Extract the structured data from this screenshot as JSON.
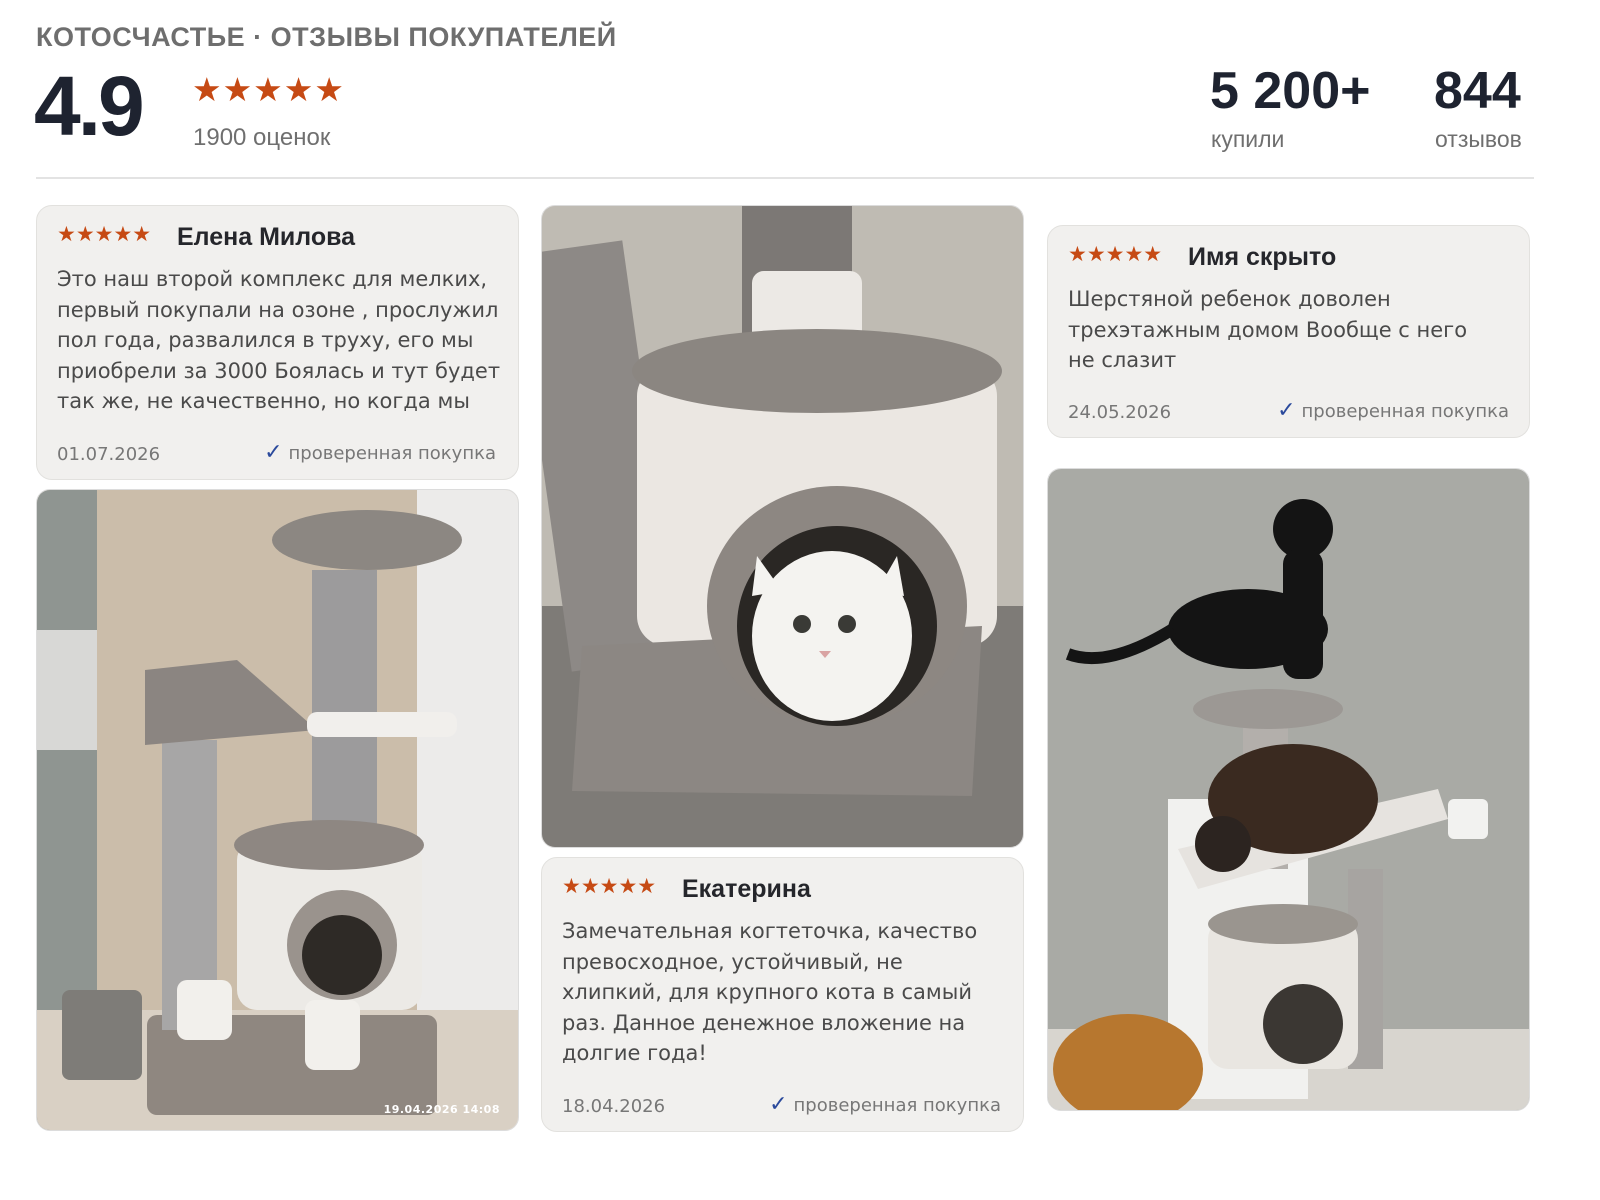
{
  "header": {
    "brand": "КОТОСЧАСТЬЕ · ОТЗЫВЫ ПОКУПАТЕЛЕЙ",
    "rating": "4.9",
    "stars": "★★★★★",
    "ratings_count": "1900 оценок",
    "stats": [
      {
        "value": "5 200+",
        "label": "купили"
      },
      {
        "value": "844",
        "label": "отзывов"
      }
    ]
  },
  "colors": {
    "accent_star": "#c64a14",
    "verified_check": "#2b4a9c",
    "card_bg": "#f1f0ee"
  },
  "reviews": [
    {
      "stars": "★★★★★",
      "author": "Елена Милова",
      "text": "Это наш второй комплекс для мелких, первый покупали на озоне , прослужил пол года, развалился в труху, его мы приобрели за 3000 Боялась и тут будет так же, не качественно, но когда мы е...",
      "date": "01.07.2026",
      "verified": "проверенная покупка"
    },
    {
      "stars": "★★★★★",
      "author": "Екатерина",
      "text": "Замечательная когтеточка, качество превосходное, устойчивый, не хлипкий, для крупного кота в самый раз. Данное денежное вложение на долгие года!",
      "date": "18.04.2026",
      "verified": "проверенная покупка"
    },
    {
      "stars": "★★★★★",
      "author": "Имя скрыто",
      "text": "Шерстяной ребенок доволен трехэтажным домом   Вообще с него не слазит",
      "date": "24.05.2026",
      "verified": "проверенная покупка"
    }
  ],
  "photos": [
    {
      "icon": "cat-tree-photo",
      "stamp": "19.04.2026  14:08"
    },
    {
      "icon": "white-cat-in-house-photo"
    },
    {
      "icon": "two-cats-on-tree-photo"
    }
  ],
  "icons": {
    "check": "check-icon",
    "star": "star-icon"
  }
}
